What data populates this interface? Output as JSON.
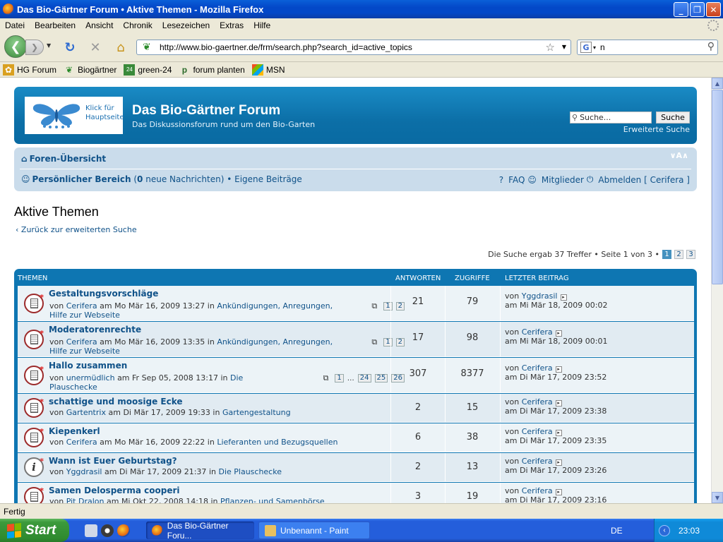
{
  "window": {
    "title": "Das Bio-Gärtner Forum • Aktive Themen - Mozilla Firefox"
  },
  "menu": [
    "Datei",
    "Bearbeiten",
    "Ansicht",
    "Chronik",
    "Lesezeichen",
    "Extras",
    "Hilfe"
  ],
  "urlbar": {
    "url": "http://www.bio-gaertner.de/frm/search.php?search_id=active_topics"
  },
  "searchbar": {
    "value": "n"
  },
  "bookmarks": [
    "HG Forum",
    "Biogärtner",
    "green-24",
    "forum planten",
    "MSN"
  ],
  "forum": {
    "logo_caption_1": "Klick für",
    "logo_caption_2": "Hauptseite",
    "title": "Das Bio-Gärtner Forum",
    "description": "Das Diskussionsforum rund um den Bio-Garten",
    "search_placeholder": "Suche...",
    "search_button": "Suche",
    "advanced_search": "Erweiterte Suche",
    "nav_index": "Foren-Übersicht",
    "font_size": "∨A∧",
    "ucp": "Persönlicher Bereich",
    "pm_count": "0",
    "pm_label": "neue Nachrichten",
    "own_posts": "Eigene Beiträge",
    "faq": "FAQ",
    "members": "Mitglieder",
    "logout": "Abmelden [ Cerifera ]",
    "page_title": "Aktive Themen",
    "back_link": "Zurück zur erweiterten Suche",
    "result_text": "Die Suche ergab 37 Treffer • Seite 1 von 3 •",
    "pages": [
      "1",
      "2",
      "3"
    ],
    "columns": {
      "topics": "THEMEN",
      "answers": "ANTWORTEN",
      "views": "ZUGRIFFE",
      "last_post": "LETZTER BEITRAG"
    },
    "topics": [
      {
        "title": "Gestaltungsvorschläge",
        "author": "Cerifera",
        "date": "Mo Mär 16, 2009 13:27",
        "forum": "Ankündigungen, Anregungen,",
        "forum2": "Hilfe zur Webseite",
        "pages": [
          "1",
          "2"
        ],
        "answers": "21",
        "views": "79",
        "last_author": "Yggdrasil",
        "last_date": "Mi Mär 18, 2009 00:02",
        "icon": "topic"
      },
      {
        "title": "Moderatorenrechte",
        "author": "Cerifera",
        "date": "Mo Mär 16, 2009 13:35",
        "forum": "Ankündigungen, Anregungen,",
        "forum2": "Hilfe zur Webseite",
        "pages": [
          "1",
          "2"
        ],
        "answers": "17",
        "views": "98",
        "last_author": "Cerifera",
        "last_date": "Mi Mär 18, 2009 00:01",
        "icon": "topic"
      },
      {
        "title": "Hallo zusammen",
        "author": "unermüdlich",
        "date": "Fr Sep 05, 2008 13:17",
        "forum": "Die",
        "forum2": "Plauschecke",
        "pages": [
          "1",
          "…",
          "24",
          "25",
          "26"
        ],
        "answers": "307",
        "views": "8377",
        "last_author": "Cerifera",
        "last_date": "Di Mär 17, 2009 23:52",
        "icon": "topic"
      },
      {
        "title": "schattige und moosige Ecke",
        "author": "Gartentrix",
        "date": "Di Mär 17, 2009 19:33",
        "forum": "Gartengestaltung",
        "forum2": "",
        "pages": [],
        "answers": "2",
        "views": "15",
        "last_author": "Cerifera",
        "last_date": "Di Mär 17, 2009 23:38",
        "icon": "topic"
      },
      {
        "title": "Kiepenkerl",
        "author": "Cerifera",
        "date": "Mo Mär 16, 2009 22:22",
        "forum": "Lieferanten und Bezugsquellen",
        "forum2": "",
        "pages": [],
        "answers": "6",
        "views": "38",
        "last_author": "Cerifera",
        "last_date": "Di Mär 17, 2009 23:35",
        "icon": "topic"
      },
      {
        "title": "Wann ist Euer Geburtstag?",
        "author": "Yggdrasil",
        "date": "Di Mär 17, 2009 21:37",
        "forum": "Die Plauschecke",
        "forum2": "",
        "pages": [],
        "answers": "2",
        "views": "13",
        "last_author": "Cerifera",
        "last_date": "Di Mär 17, 2009 23:26",
        "icon": "info"
      },
      {
        "title": "Samen Delosperma cooperi",
        "author": "Pit Dralon",
        "date": "Mi Okt 22, 2008 14:18",
        "forum": "Pflanzen- und Samenbörse",
        "forum2": "",
        "pages": [],
        "answers": "3",
        "views": "19",
        "last_author": "Cerifera",
        "last_date": "Di Mär 17, 2009 23:16",
        "icon": "topic"
      }
    ],
    "by_label": "von",
    "on_label": "am",
    "in_label": "in"
  },
  "statusbar": {
    "text": "Fertig"
  },
  "taskbar": {
    "start": "Start",
    "tasks": [
      "Das Bio-Gärtner Foru...",
      "Unbenannt - Paint"
    ],
    "lang": "DE",
    "clock": "23:03"
  }
}
